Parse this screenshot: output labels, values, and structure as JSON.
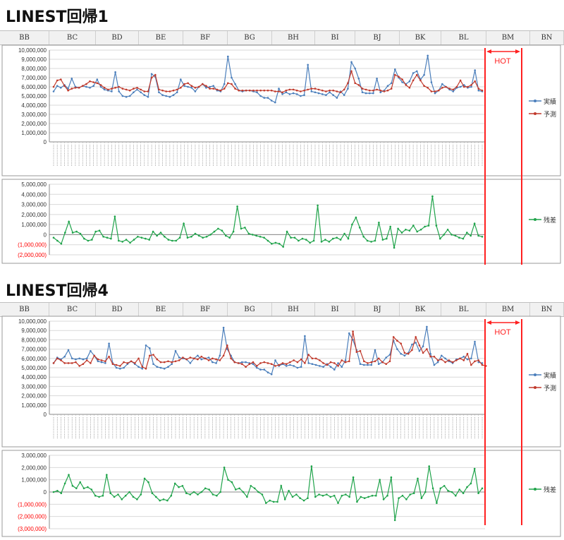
{
  "sections": [
    {
      "title": "LINEST回帰1"
    },
    {
      "title": "LINEST回帰4"
    }
  ],
  "columns": [
    "BB",
    "BC",
    "BD",
    "BE",
    "BF",
    "BG",
    "BH",
    "BI",
    "BJ",
    "BK",
    "BL",
    "BM",
    "BN"
  ],
  "hot_label": "HOT",
  "colors": {
    "actual": "#4a7ebb",
    "predicted": "#c0392b",
    "residual": "#1fa34a",
    "hot": "#ff2020",
    "negative_tick": "#ff0000"
  },
  "chart_data": [
    {
      "id": "c1-main",
      "type": "line",
      "ylim": [
        0,
        10000000
      ],
      "yticks": [
        "0",
        "1,000,000",
        "2,000,000",
        "3,000,000",
        "4,000,000",
        "5,000,000",
        "6,000,000",
        "7,000,000",
        "8,000,000",
        "9,000,000",
        "10,000,000"
      ],
      "series": [
        {
          "name": "実績",
          "values": [
            5500000,
            6100000,
            5900000,
            6200000,
            5800000,
            6900000,
            6000000,
            5900000,
            6100000,
            6000000,
            5900000,
            6100000,
            6800000,
            6000000,
            5700000,
            5600000,
            5500000,
            7600000,
            5500000,
            5000000,
            4900000,
            5000000,
            5400000,
            5700000,
            5400000,
            5100000,
            4900000,
            7400000,
            7100000,
            5400000,
            5100000,
            5000000,
            4900000,
            5100000,
            5400000,
            6800000,
            6100000,
            6000000,
            5900000,
            5500000,
            6000000,
            6300000,
            5900000,
            6000000,
            6100000,
            5600000,
            5500000,
            6300000,
            9300000,
            7000000,
            6300000,
            5600000,
            5500000,
            5600000,
            5600000,
            5500000,
            5400000,
            5000000,
            4800000,
            4800000,
            4500000,
            4300000,
            5800000,
            5200000,
            5400000,
            5200000,
            5300000,
            5200000,
            5000000,
            5100000,
            8400000,
            5500000,
            5400000,
            5300000,
            5200000,
            5100000,
            5400000,
            5100000,
            4800000,
            5500000,
            5100000,
            5800000,
            8700000,
            8000000,
            6900000,
            5400000,
            5300000,
            5300000,
            5300000,
            6900000,
            5400000,
            5600000,
            6100000,
            6400000,
            7900000,
            7000000,
            6500000,
            6300000,
            6600000,
            7500000,
            7700000,
            6800000,
            7300000,
            9400000,
            6500000,
            5300000,
            5600000,
            6300000,
            6000000,
            5700000,
            5500000,
            5900000,
            6000000,
            6200000,
            5900000,
            6000000,
            7800000,
            5600000,
            5500000
          ]
        },
        {
          "name": "予測",
          "values": [
            6000000,
            6700000,
            6800000,
            6100000,
            5600000,
            5800000,
            5900000,
            5900000,
            6100000,
            6300000,
            6600000,
            6500000,
            6400000,
            6200000,
            5900000,
            5700000,
            5800000,
            5900000,
            6000000,
            5800000,
            5700000,
            5600000,
            5800000,
            5900000,
            5700000,
            5500000,
            5500000,
            7000000,
            7300000,
            5700000,
            5600000,
            5500000,
            5500000,
            5600000,
            5700000,
            5900000,
            6300000,
            6400000,
            6100000,
            5900000,
            6000000,
            6300000,
            6100000,
            5800000,
            5800000,
            5700000,
            5600000,
            5800000,
            6400000,
            6300000,
            5800000,
            5600000,
            5600000,
            5600000,
            5600000,
            5600000,
            5600000,
            5600000,
            5600000,
            5600000,
            5600000,
            5500000,
            5500000,
            5400000,
            5600000,
            5700000,
            5700000,
            5600000,
            5500000,
            5600000,
            5700000,
            5800000,
            5800000,
            5700000,
            5600000,
            5500000,
            5600000,
            5600000,
            5500000,
            5400000,
            5700000,
            6400000,
            7700000,
            6400000,
            6200000,
            5800000,
            5700000,
            5600000,
            5600000,
            5700000,
            5600000,
            5500000,
            5600000,
            5800000,
            7300000,
            7100000,
            6800000,
            6200000,
            5900000,
            6700000,
            7300000,
            6700000,
            6100000,
            5900000,
            5500000,
            5500000,
            5600000,
            5900000,
            6000000,
            5800000,
            5700000,
            6000000,
            6700000,
            6000000,
            6000000,
            6200000,
            6600000,
            5800000,
            5600000
          ]
        }
      ]
    },
    {
      "id": "c1-resid",
      "type": "line",
      "ylim": [
        -2000000,
        5000000
      ],
      "yticks": [
        "(2,000,000)",
        "(1,000,000)",
        "0",
        "1,000,000",
        "2,000,000",
        "3,000,000",
        "4,000,000",
        "5,000,000"
      ],
      "series": [
        {
          "name": "残差",
          "values": [
            -300000,
            -600000,
            -900000,
            200000,
            1300000,
            200000,
            300000,
            100000,
            -400000,
            -600000,
            -500000,
            300000,
            400000,
            -200000,
            -300000,
            -400000,
            1800000,
            -600000,
            -700000,
            -500000,
            -800000,
            -500000,
            -200000,
            -300000,
            -400000,
            -500000,
            300000,
            -100000,
            200000,
            -200000,
            -500000,
            -600000,
            -600000,
            -300000,
            1100000,
            -300000,
            -200000,
            100000,
            -100000,
            -300000,
            -200000,
            0,
            300000,
            600000,
            400000,
            -100000,
            -300000,
            300000,
            2800000,
            600000,
            700000,
            100000,
            0,
            -100000,
            -200000,
            -300000,
            -600000,
            -900000,
            -800000,
            -900000,
            -1200000,
            300000,
            -300000,
            -300000,
            -600000,
            -400000,
            -500000,
            -800000,
            -600000,
            2900000,
            -700000,
            -500000,
            -700000,
            -400000,
            -300000,
            -500000,
            100000,
            -400000,
            1000000,
            1700000,
            700000,
            -200000,
            -600000,
            -700000,
            -600000,
            1200000,
            -500000,
            -400000,
            800000,
            -1300000,
            600000,
            200000,
            500000,
            400000,
            900000,
            300000,
            500000,
            800000,
            900000,
            3800000,
            900000,
            -400000,
            0,
            500000,
            0,
            -100000,
            -300000,
            -400000,
            200000,
            -100000,
            1100000,
            -100000,
            -200000
          ]
        }
      ]
    },
    {
      "id": "c4-main",
      "type": "line",
      "ylim": [
        0,
        10000000
      ],
      "yticks": [
        "0",
        "1,000,000",
        "2,000,000",
        "3,000,000",
        "4,000,000",
        "5,000,000",
        "6,000,000",
        "7,000,000",
        "8,000,000",
        "9,000,000",
        "10,000,000"
      ],
      "series": [
        {
          "name": "実績",
          "values": [
            5500000,
            6100000,
            5900000,
            6200000,
            6900000,
            6000000,
            5900000,
            6000000,
            5900000,
            6000000,
            6800000,
            6300000,
            5700000,
            5600000,
            5500000,
            7600000,
            5500000,
            5000000,
            4900000,
            5000000,
            5400000,
            5700000,
            5400000,
            5100000,
            4900000,
            7400000,
            7100000,
            5400000,
            5100000,
            5000000,
            4900000,
            5100000,
            5400000,
            6800000,
            6100000,
            6000000,
            5900000,
            5500000,
            6000000,
            6300000,
            5900000,
            6000000,
            6100000,
            5600000,
            5500000,
            6300000,
            9300000,
            7000000,
            6300000,
            5600000,
            5500000,
            5600000,
            5600000,
            5500000,
            5400000,
            5000000,
            4800000,
            4800000,
            4500000,
            4300000,
            5800000,
            5200000,
            5400000,
            5200000,
            5300000,
            5200000,
            5000000,
            5100000,
            8400000,
            5500000,
            5400000,
            5300000,
            5200000,
            5100000,
            5400000,
            5100000,
            4800000,
            5500000,
            5100000,
            5800000,
            8700000,
            8000000,
            6900000,
            5400000,
            5300000,
            5300000,
            5300000,
            6900000,
            5400000,
            5600000,
            6100000,
            6400000,
            7900000,
            7000000,
            6500000,
            6300000,
            6600000,
            7500000,
            7700000,
            6800000,
            7300000,
            9400000,
            6500000,
            5300000,
            5600000,
            6300000,
            6000000,
            5700000,
            5500000,
            5900000,
            6000000,
            6200000,
            5900000,
            6000000,
            7800000,
            5600000,
            5500000
          ]
        },
        {
          "name": "予測",
          "values": [
            5500000,
            6000000,
            5800000,
            5500000,
            5500000,
            5500000,
            5600000,
            5200000,
            5400000,
            5800000,
            5500000,
            6300000,
            5900000,
            5800000,
            5700000,
            6200000,
            5400000,
            5300000,
            5200000,
            5600000,
            5500000,
            5700000,
            5500000,
            6000000,
            5100000,
            4900000,
            6300000,
            6400000,
            5900000,
            5600000,
            5600000,
            5700000,
            5600000,
            5700000,
            5800000,
            6100000,
            5900000,
            6100000,
            6000000,
            5900000,
            6200000,
            6000000,
            5800000,
            6000000,
            5900000,
            5800000,
            6300000,
            7400000,
            6000000,
            5600000,
            5500000,
            5400000,
            5100000,
            5400000,
            5600000,
            5200000,
            5500000,
            5600000,
            5500000,
            5400000,
            5200000,
            5300000,
            5500000,
            5400000,
            5600000,
            5800000,
            5600000,
            5900000,
            5500000,
            6400000,
            6000000,
            6000000,
            5800000,
            5500000,
            5300000,
            5600000,
            5500000,
            5200000,
            5800000,
            5600000,
            5700000,
            8900000,
            6700000,
            6800000,
            5700000,
            5500000,
            5600000,
            5700000,
            6000000,
            5600000,
            5400000,
            5700000,
            8300000,
            7900000,
            7600000,
            6600000,
            6500000,
            6900000,
            8300000,
            7400000,
            6600000,
            7000000,
            6200000,
            6200000,
            5800000,
            5900000,
            5600000,
            5800000,
            5600000,
            5800000,
            6000000,
            5800000,
            6500000,
            5300000,
            5700000,
            5800000,
            5300000,
            5200000
          ]
        }
      ]
    },
    {
      "id": "c4-resid",
      "type": "line",
      "ylim": [
        -3000000,
        3000000
      ],
      "yticks": [
        "(3,000,000)",
        "(2,000,000)",
        "(1,000,000)",
        "0",
        "1,000,000",
        "2,000,000",
        "3,000,000"
      ],
      "series": [
        {
          "name": "残差",
          "values": [
            0,
            100000,
            -100000,
            700000,
            1400000,
            500000,
            300000,
            800000,
            300000,
            400000,
            200000,
            -300000,
            -400000,
            -300000,
            1400000,
            -100000,
            -400000,
            -200000,
            -600000,
            -300000,
            0,
            -400000,
            -600000,
            -200000,
            1100000,
            800000,
            -100000,
            -400000,
            -700000,
            -600000,
            -700000,
            -300000,
            700000,
            400000,
            500000,
            -100000,
            -200000,
            0,
            -200000,
            0,
            300000,
            200000,
            -200000,
            -300000,
            0,
            2000000,
            1000000,
            800000,
            200000,
            300000,
            0,
            -400000,
            500000,
            300000,
            0,
            -200000,
            -900000,
            -700000,
            -800000,
            -800000,
            500000,
            -600000,
            100000,
            -400000,
            -200000,
            -500000,
            -700000,
            -500000,
            2100000,
            -400000,
            -200000,
            -300000,
            -200000,
            -400000,
            -300000,
            -900000,
            -300000,
            -200000,
            -400000,
            1200000,
            -800000,
            -400000,
            -500000,
            -400000,
            -300000,
            -300000,
            1000000,
            -600000,
            -300000,
            1200000,
            -2300000,
            -500000,
            -300000,
            -600000,
            -200000,
            -100000,
            1100000,
            -500000,
            0,
            2100000,
            300000,
            -900000,
            300000,
            500000,
            100000,
            0,
            -300000,
            200000,
            -100000,
            400000,
            700000,
            1900000,
            -100000,
            300000
          ]
        }
      ]
    }
  ]
}
